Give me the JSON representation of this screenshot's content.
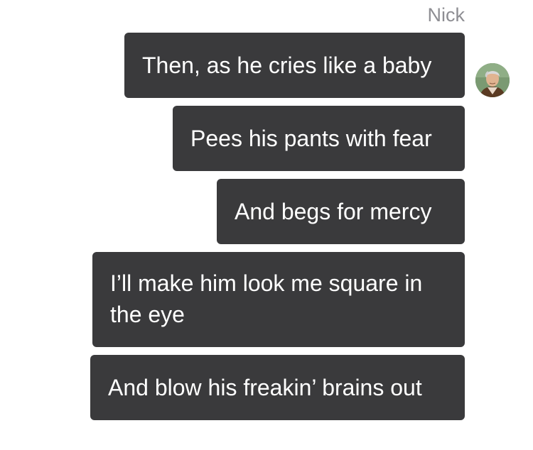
{
  "conversation": {
    "sender_name": "Nick",
    "messages": [
      "Then, as he cries like a baby",
      "Pees his pants with fear",
      "And begs for mercy",
      "I’ll make him look me square in the eye",
      "And blow his freakin’ brains out"
    ],
    "avatar_icon": "avatar-icon",
    "colors": {
      "bubble": "#3a3a3c",
      "bubble_text": "#ffffff",
      "sender_name": "#8e8e93",
      "background": "#ffffff"
    }
  }
}
